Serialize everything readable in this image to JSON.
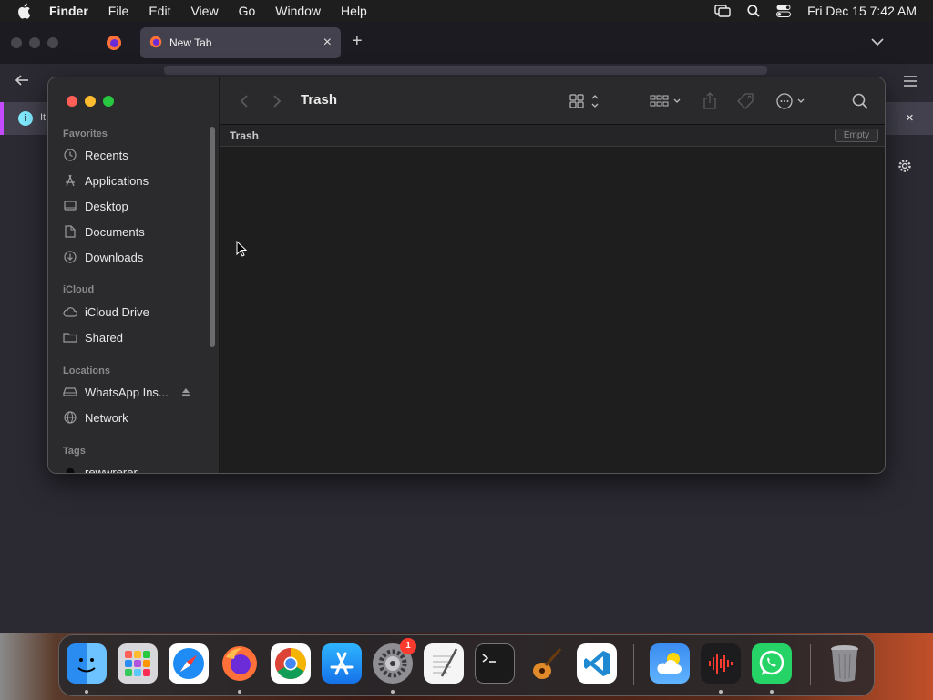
{
  "menubar": {
    "app_name": "Finder",
    "items": [
      "File",
      "Edit",
      "View",
      "Go",
      "Window",
      "Help"
    ],
    "datetime": "Fri Dec 15  7:42 AM"
  },
  "browser": {
    "tab_title": "New Tab",
    "tab_close": "×",
    "new_tab": "+",
    "info_text": "It",
    "info_close": "×",
    "accent_color": "#c54bff"
  },
  "finder": {
    "window_title": "Trash",
    "path_title": "Trash",
    "empty_button": "Empty",
    "sidebar": {
      "favorites_header": "Favorites",
      "favorites": [
        {
          "label": "Recents",
          "icon": "clock-icon"
        },
        {
          "label": "Applications",
          "icon": "applications-icon"
        },
        {
          "label": "Desktop",
          "icon": "desktop-icon"
        },
        {
          "label": "Documents",
          "icon": "document-icon"
        },
        {
          "label": "Downloads",
          "icon": "download-icon"
        }
      ],
      "icloud_header": "iCloud",
      "icloud": [
        {
          "label": "iCloud Drive",
          "icon": "cloud-icon"
        },
        {
          "label": "Shared",
          "icon": "shared-folder-icon"
        }
      ],
      "locations_header": "Locations",
      "locations": [
        {
          "label": "WhatsApp Ins...",
          "icon": "disk-icon"
        },
        {
          "label": "Network",
          "icon": "network-icon"
        }
      ],
      "tags_header": "Tags",
      "tags": [
        {
          "label": "rewwrerer",
          "icon": "tag-dot-icon"
        }
      ]
    }
  },
  "dock": {
    "apps": [
      "Finder",
      "Launchpad",
      "Safari",
      "Firefox",
      "Chrome",
      "App Store",
      "System Settings",
      "TextEdit",
      "Terminal",
      "GarageBand",
      "VS Code",
      "Weather",
      "Voice Memos",
      "WhatsApp",
      "Trash"
    ],
    "settings_badge": "1"
  }
}
